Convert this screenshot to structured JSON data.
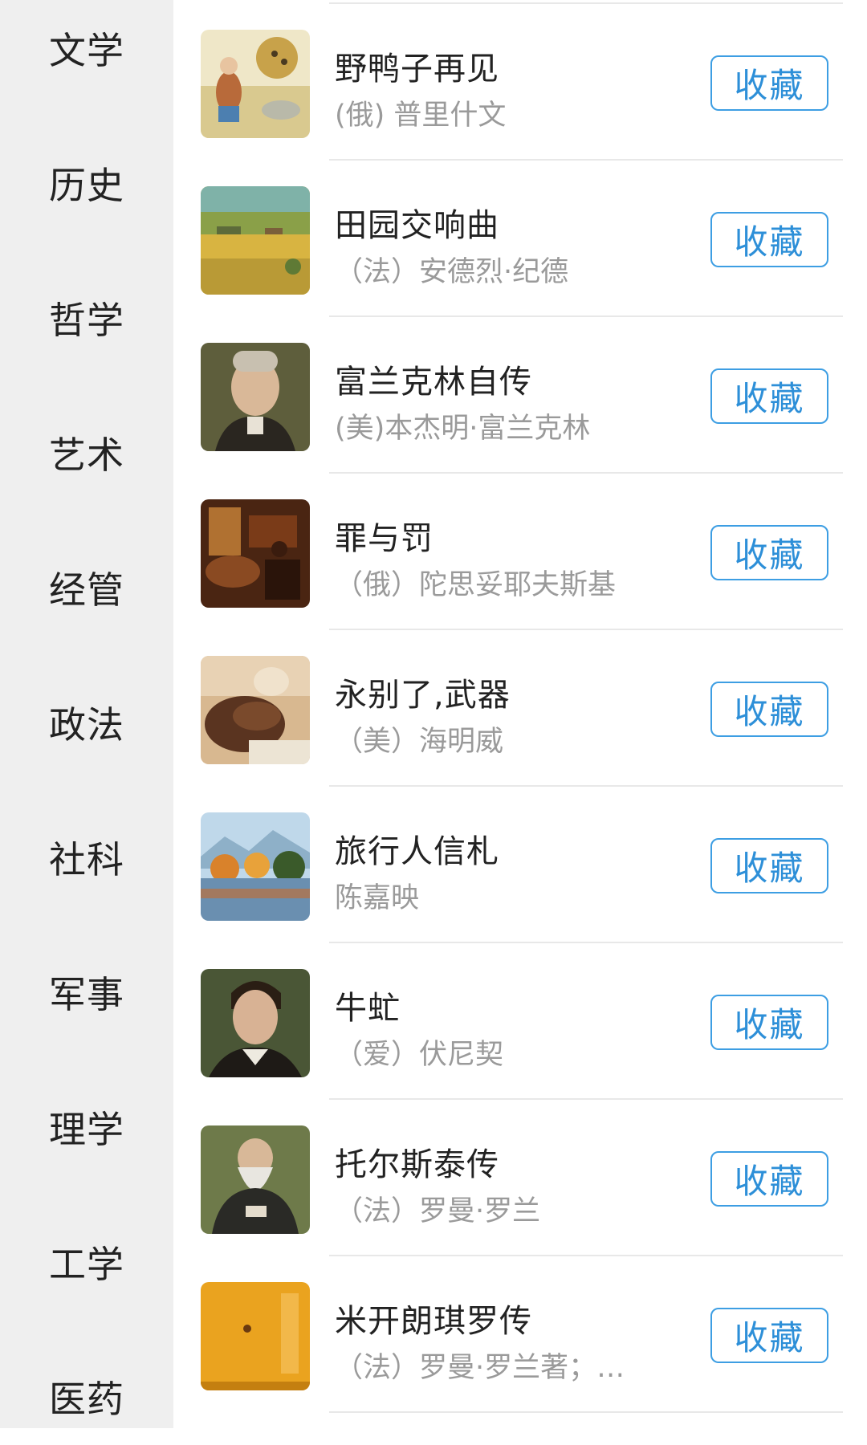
{
  "sidebar": {
    "categories": [
      "文学",
      "历史",
      "哲学",
      "艺术",
      "经管",
      "政法",
      "社科",
      "军事",
      "理学",
      "工学",
      "医药"
    ]
  },
  "action": {
    "favorite_label": "收藏"
  },
  "books": [
    {
      "title": "野鸭子再见",
      "author": "(俄) 普里什文"
    },
    {
      "title": "田园交响曲",
      "author": "（法）安德烈·纪德"
    },
    {
      "title": "富兰克林自传",
      "author": "(美)本杰明·富兰克林"
    },
    {
      "title": "罪与罚",
      "author": "（俄）陀思妥耶夫斯基"
    },
    {
      "title": "永别了,武器",
      "author": "（美）海明威"
    },
    {
      "title": "旅行人信札",
      "author": "陈嘉映"
    },
    {
      "title": "牛虻",
      "author": "（爱）伏尼契"
    },
    {
      "title": "托尔斯泰传",
      "author": "（法）罗曼·罗兰"
    },
    {
      "title": "米开朗琪罗传",
      "author": "（法）罗曼·罗兰著；傅..."
    }
  ]
}
